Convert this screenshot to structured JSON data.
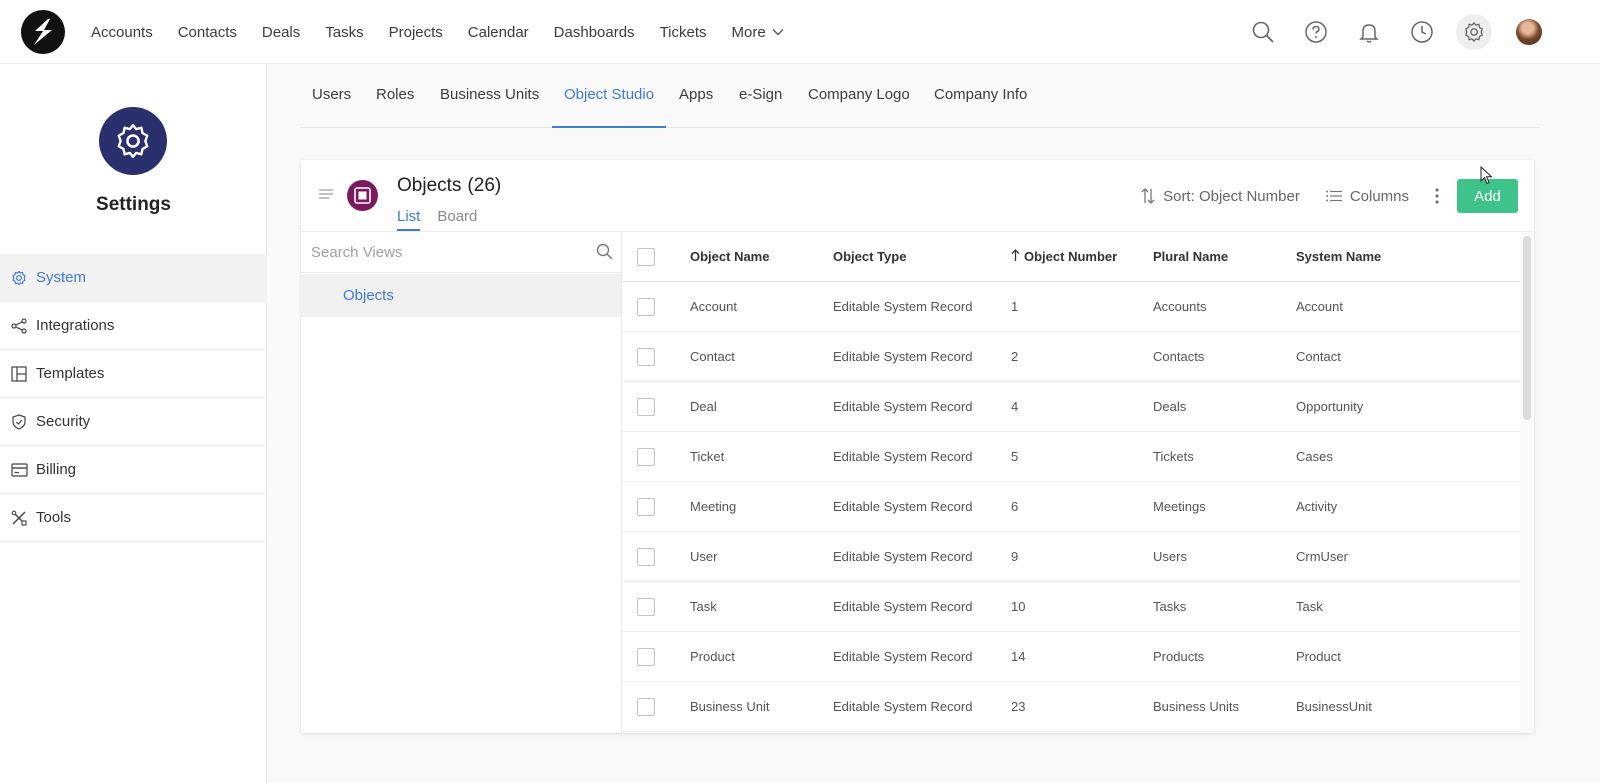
{
  "topnav": {
    "items": [
      "Accounts",
      "Contacts",
      "Deals",
      "Tasks",
      "Projects",
      "Calendar",
      "Dashboards",
      "Tickets"
    ],
    "more_label": "More",
    "icons": [
      "search-icon",
      "help-icon",
      "bell-icon",
      "clock-icon",
      "gear-icon"
    ]
  },
  "sidebar": {
    "title": "Settings",
    "items": [
      {
        "label": "System",
        "icon": "gear-icon",
        "active": true
      },
      {
        "label": "Integrations",
        "icon": "share-icon"
      },
      {
        "label": "Templates",
        "icon": "layout-icon"
      },
      {
        "label": "Security",
        "icon": "shield-icon"
      },
      {
        "label": "Billing",
        "icon": "card-icon"
      },
      {
        "label": "Tools",
        "icon": "tools-icon"
      }
    ]
  },
  "tabs": [
    "Users",
    "Roles",
    "Business Units",
    "Object Studio",
    "Apps",
    "e-Sign",
    "Company Logo",
    "Company Info"
  ],
  "active_tab": "Object Studio",
  "card": {
    "title": "Objects",
    "count": "(26)",
    "view_tabs": [
      "List",
      "Board"
    ],
    "sort_label": "Sort: Object Number",
    "columns_label": "Columns",
    "add_label": "Add"
  },
  "views": {
    "search_placeholder": "Search Views",
    "items": [
      "Objects"
    ]
  },
  "table": {
    "headers": [
      "Object Name",
      "Object Type",
      "Object Number",
      "Plural Name",
      "System Name"
    ],
    "rows": [
      [
        "Account",
        "Editable System Record",
        "1",
        "Accounts",
        "Account"
      ],
      [
        "Contact",
        "Editable System Record",
        "2",
        "Contacts",
        "Contact"
      ],
      [
        "Deal",
        "Editable System Record",
        "4",
        "Deals",
        "Opportunity"
      ],
      [
        "Ticket",
        "Editable System Record",
        "5",
        "Tickets",
        "Cases"
      ],
      [
        "Meeting",
        "Editable System Record",
        "6",
        "Meetings",
        "Activity"
      ],
      [
        "User",
        "Editable System Record",
        "9",
        "Users",
        "CrmUser"
      ],
      [
        "Task",
        "Editable System Record",
        "10",
        "Tasks",
        "Task"
      ],
      [
        "Product",
        "Editable System Record",
        "14",
        "Products",
        "Product"
      ],
      [
        "Business Unit",
        "Editable System Record",
        "23",
        "Business Units",
        "BusinessUnit"
      ]
    ]
  },
  "colors": {
    "accent": "#3e7bd6",
    "add_button": "#3ec38a",
    "settings_badge": "#2a2f6e",
    "object_badge": "#7b1b5e"
  }
}
